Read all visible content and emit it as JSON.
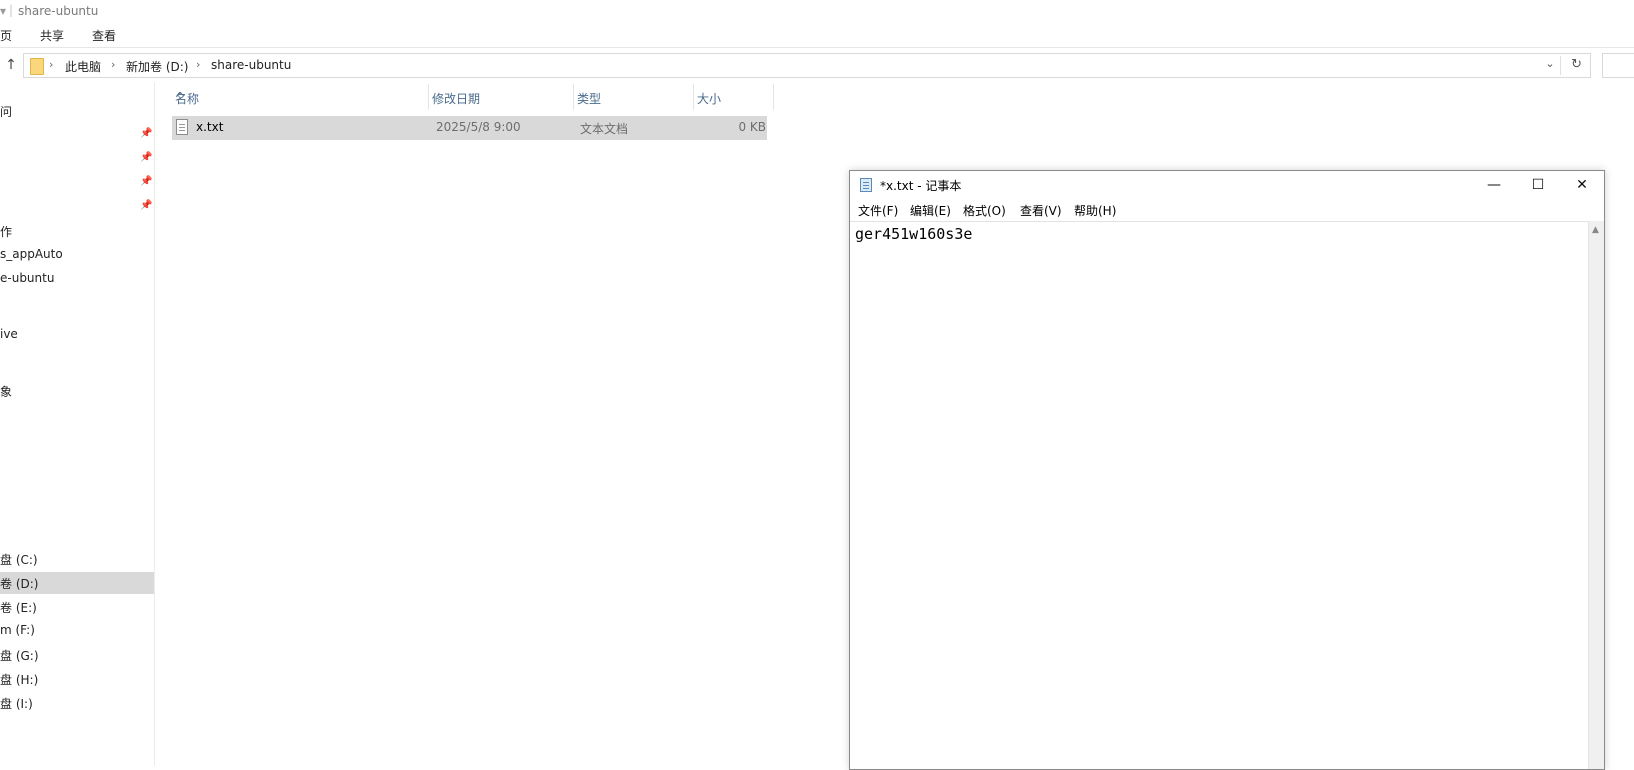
{
  "explorer": {
    "title": "share-ubuntu",
    "title_prefix": "▾",
    "ribbon_tabs": [
      "页",
      "共享",
      "查看"
    ],
    "address": {
      "crumbs": [
        "此电脑",
        "新加卷 (D:)",
        "share-ubuntu"
      ],
      "chevron": "›",
      "dropdown_glyph": "⌄",
      "refresh_glyph": "↻"
    },
    "up_glyph": "↑",
    "nav_items": [
      {
        "label": "问"
      },
      {
        "label": ""
      },
      {
        "label": ""
      },
      {
        "label": ""
      },
      {
        "label": ""
      },
      {
        "label": "作"
      },
      {
        "label": "s_appAuto"
      },
      {
        "label": "e-ubuntu"
      },
      {
        "label": "ive"
      },
      {
        "label": "象"
      },
      {
        "label": "盘 (C:)"
      },
      {
        "label": "卷 (D:)"
      },
      {
        "label": "卷 (E:)"
      },
      {
        "label": "m (F:)"
      },
      {
        "label": "盘 (G:)"
      },
      {
        "label": "盘 (H:)"
      },
      {
        "label": "盘 (I:)"
      }
    ],
    "pin_glyph": "📌",
    "columns": {
      "name": "名称",
      "modified": "修改日期",
      "type": "类型",
      "size": "大小"
    },
    "sort_caret": "^",
    "files": [
      {
        "name": "x.txt",
        "modified": "2025/5/8 9:00",
        "type": "文本文档",
        "size": "0 KB"
      }
    ]
  },
  "notepad": {
    "title": "*x.txt - 记事本",
    "window_buttons": {
      "minimize": "—",
      "maximize": "☐",
      "close": "✕"
    },
    "menu": [
      "文件(F)",
      "编辑(E)",
      "格式(O)",
      "查看(V)",
      "帮助(H)"
    ],
    "content": "ger451w160s3e",
    "scroll_up_glyph": "▲"
  }
}
